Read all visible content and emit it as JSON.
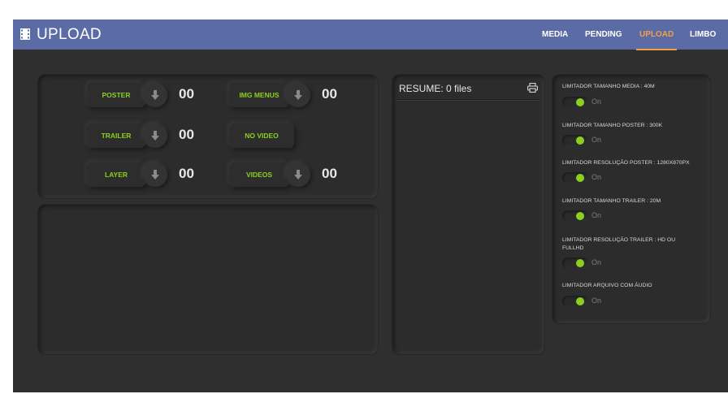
{
  "header": {
    "title": "UPLOAD",
    "nav": [
      "MEDIA",
      "PENDING",
      "UPLOAD",
      "LIMBO"
    ],
    "active_nav": "UPLOAD"
  },
  "uploads": {
    "poster": {
      "label": "POSTER",
      "count": "00"
    },
    "img_menus": {
      "label": "IMG MENUS",
      "count": "00"
    },
    "trailer": {
      "label": "TRAILER",
      "count": "00"
    },
    "no_video": {
      "label": "NO VIDEO"
    },
    "layer": {
      "label": "LAYER",
      "count": "00"
    },
    "videos": {
      "label": "VIDEOS",
      "count": "00"
    }
  },
  "resume": {
    "title": "RESUME: 0 files"
  },
  "limiters": [
    {
      "label": "LIMITADOR TAMANHO MEDIA : 40M",
      "state": "On"
    },
    {
      "label": "LIMITADOR TAMANHO POSTER : 300K",
      "state": "On"
    },
    {
      "label": "LIMITADOR RESOLUÇÃO POSTER : 1280X870px",
      "state": "On"
    },
    {
      "label": "LIMITADOR TAMANHO TRAILER : 20M",
      "state": "On"
    },
    {
      "label": "LIMITADOR RESOLUÇÃO TRAILER : HD ou FULLHD",
      "state": "On"
    },
    {
      "label": "LIMITADOR ARQUIVO COM ÁUDIO",
      "state": "On"
    }
  ],
  "colors": {
    "header_bg": "#5b6ba6",
    "accent": "#f0a04a",
    "green": "#8bd021",
    "bg": "#2f2f2f"
  }
}
